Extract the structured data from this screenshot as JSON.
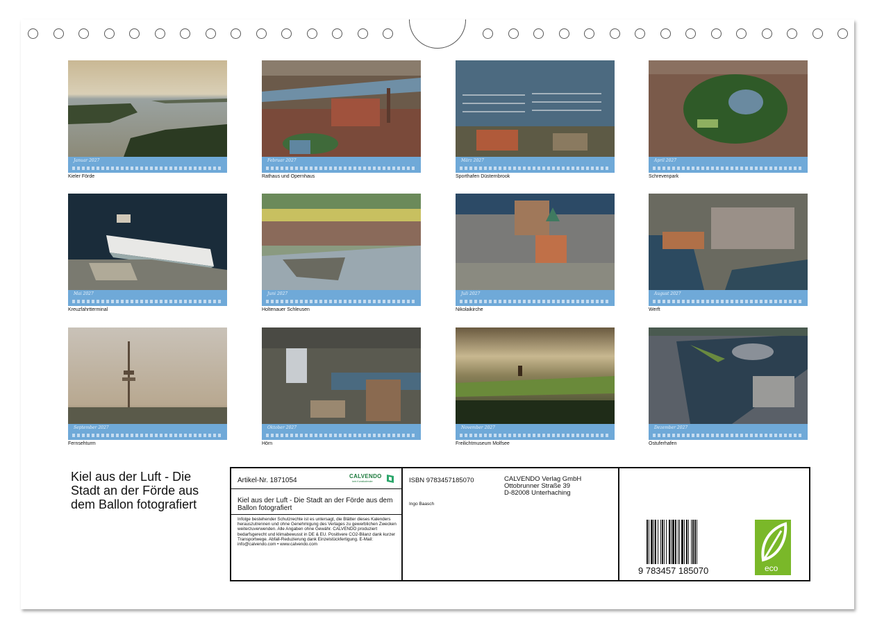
{
  "tiles": [
    {
      "caption": "Kieler Förde",
      "month": "Januar 2027"
    },
    {
      "caption": "Rathaus und Opernhaus",
      "month": "Februar 2027"
    },
    {
      "caption": "Sporthafen Düsternbrook",
      "month": "März 2027"
    },
    {
      "caption": "Schrevenpark",
      "month": "April 2027"
    },
    {
      "caption": "Kreuzfahrtterminal",
      "month": "Mai 2027"
    },
    {
      "caption": "Holtenauer Schleusen",
      "month": "Juni 2027"
    },
    {
      "caption": "Nikolaikirche",
      "month": "Juli 2027"
    },
    {
      "caption": "Werft",
      "month": "August 2027"
    },
    {
      "caption": "Fernsehturm",
      "month": "September 2027"
    },
    {
      "caption": "Hörn",
      "month": "Oktober 2027"
    },
    {
      "caption": "Freilichtmuseum Molfsee",
      "month": "November 2027"
    },
    {
      "caption": "Ostuferhafen",
      "month": "Dezember 2027"
    }
  ],
  "title": "Kiel aus der Luft - Die Stadt an der Förde aus dem Ballon fotografiert",
  "info": {
    "article_no": "Artikel-Nr. 1871054",
    "logo": "CALVENDO",
    "logo_sub": "kein Kunstkalender",
    "title": "Kiel aus der Luft - Die Stadt an der Förde aus dem Ballon fotografiert",
    "legal": "Infolge bestehender Schutzrechte ist es untersagt, die Blätter dieses Kalenders herauszutrennen und ohne Genehmigung des Verlages zu gewerblichen Zwecken weiterzuverwenden. Alle Angaben ohne Gewähr. CALVENDO produziert bedarfsgerecht und klimabewusst in DE & EU. Positivere CO2-Bilanz dank kurzer Transportwege. Abfall-Reduzierung dank Einzelstückfertigung. E-Mail: info@calvendo.com • www.calvendo.com",
    "isbn": "ISBN 9783457185070",
    "author": "Ingo Baasch",
    "publisher_name": "CALVENDO Verlag GmbH",
    "publisher_street": "Ottobrunner Straße 39",
    "publisher_city": "D-82008 Unterhaching",
    "barcode_digits": "9 783457 185070",
    "eco_label": "eco"
  }
}
